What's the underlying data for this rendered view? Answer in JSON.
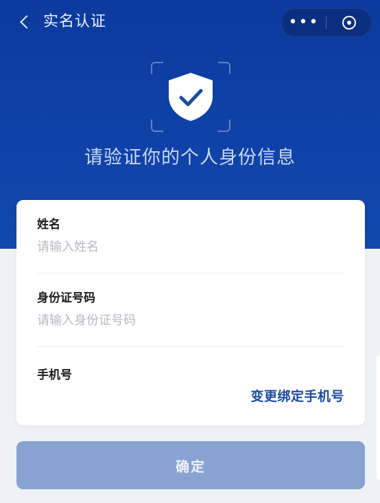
{
  "nav": {
    "title": "实名认证",
    "back_icon": "chevron-left-icon",
    "menu_dots": "•••",
    "more_icon": "more-dots-icon",
    "close_icon": "target-close-icon"
  },
  "hero": {
    "headline": "请验证你的个人身份信息",
    "icon": "shield-check-icon",
    "background_color": "#0f42a8"
  },
  "form": {
    "name": {
      "label": "姓名",
      "value": "",
      "placeholder": "请输入姓名"
    },
    "id_number": {
      "label": "身份证号码",
      "value": "",
      "placeholder": "请输入身份证号码"
    },
    "phone": {
      "label": "手机号",
      "value": "",
      "change_link": "变更绑定手机号"
    }
  },
  "confirm": {
    "label": "确定",
    "color": "#88a3d2"
  }
}
